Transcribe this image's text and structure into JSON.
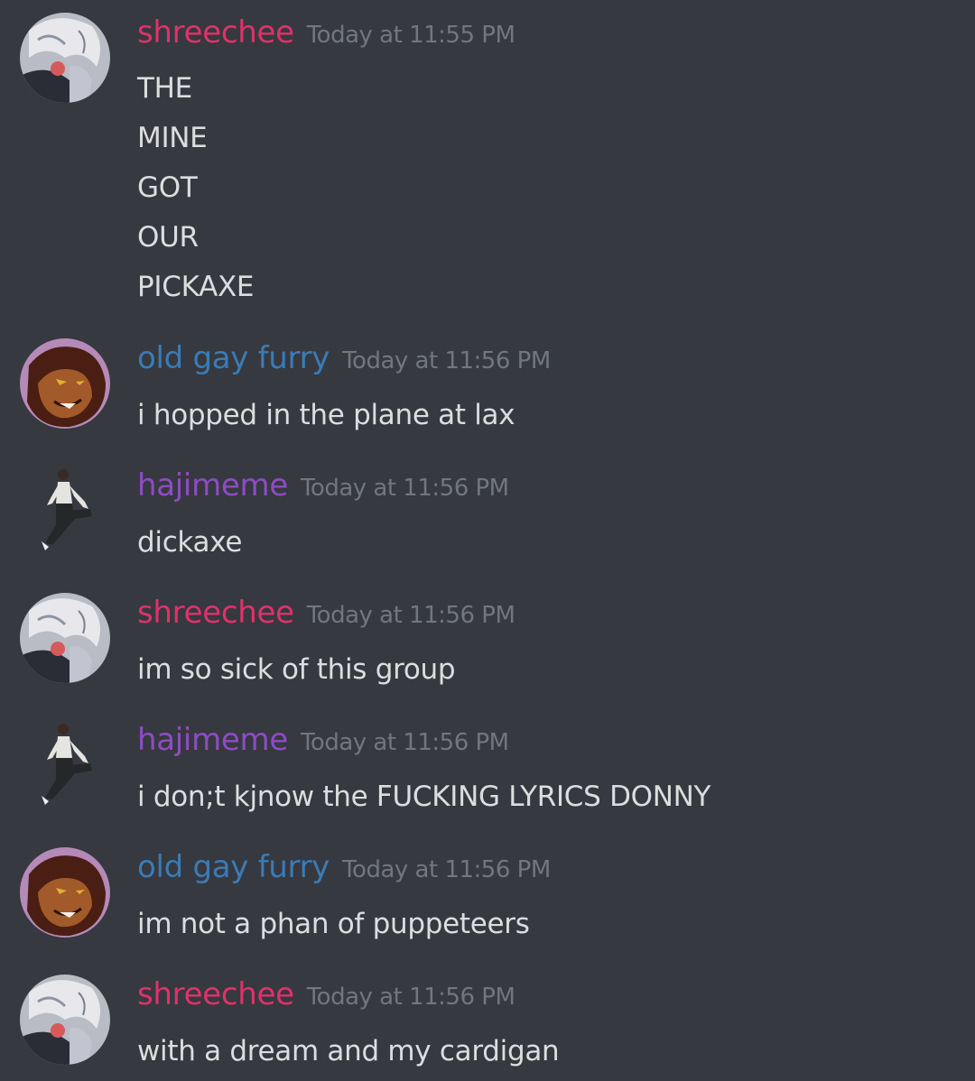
{
  "colors": {
    "background": "#36393f",
    "timestamp": "#72767d",
    "message_text": "#dcddde",
    "shreechee": "#e0316b",
    "old_gay_furry": "#3b7bb6",
    "hajimeme": "#8e4cc4"
  },
  "messages": [
    {
      "avatar_icon": "anime-white-hair-avatar-icon",
      "username": "shreechee",
      "timestamp": "Today at 11:55 PM",
      "lines": [
        "THE",
        "MINE",
        "GOT",
        "OUR",
        "PICKAXE"
      ]
    },
    {
      "avatar_icon": "lion-avatar-icon",
      "username": "old gay furry",
      "timestamp": "Today at 11:56 PM",
      "lines": [
        "i hopped in the plane at lax"
      ]
    },
    {
      "avatar_icon": "posing-figure-avatar-icon",
      "username": "hajimeme",
      "timestamp": "Today at 11:56 PM",
      "lines": [
        "dickaxe"
      ]
    },
    {
      "avatar_icon": "anime-white-hair-avatar-icon",
      "username": "shreechee",
      "timestamp": "Today at 11:56 PM",
      "lines": [
        "im so sick of this group"
      ]
    },
    {
      "avatar_icon": "posing-figure-avatar-icon",
      "username": "hajimeme",
      "timestamp": "Today at 11:56 PM",
      "lines": [
        "i don;t kjnow the FUCKING LYRICS DONNY"
      ]
    },
    {
      "avatar_icon": "lion-avatar-icon",
      "username": "old gay furry",
      "timestamp": "Today at 11:56 PM",
      "lines": [
        "im not a phan of puppeteers"
      ]
    },
    {
      "avatar_icon": "anime-white-hair-avatar-icon",
      "username": "shreechee",
      "timestamp": "Today at 11:56 PM",
      "lines": [
        "with a dream and my cardigan"
      ]
    }
  ]
}
